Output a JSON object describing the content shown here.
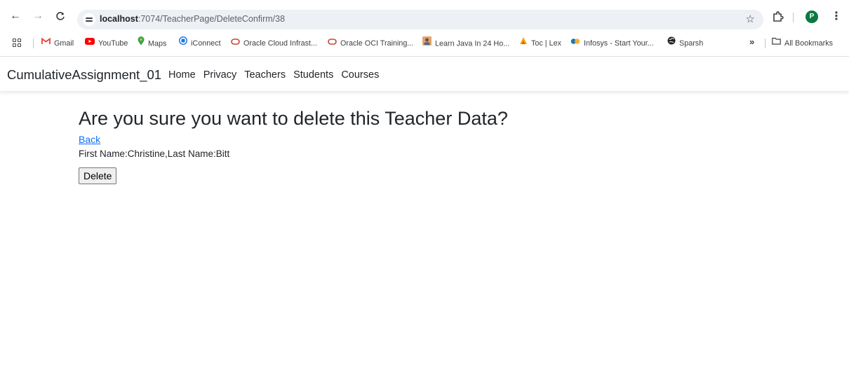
{
  "browser": {
    "url_host": "localhost",
    "url_path": ":7074/TeacherPage/DeleteConfirm/38",
    "profile_initial": "P",
    "bookmarks": [
      {
        "label": "Gmail",
        "icon": "gmail-icon",
        "color": "#ea4335"
      },
      {
        "label": "YouTube",
        "icon": "youtube-icon",
        "color": "#ff0000"
      },
      {
        "label": "Maps",
        "icon": "maps-pin-icon",
        "color": "#34a853"
      },
      {
        "label": "iConnect",
        "icon": "iconnect-icon",
        "color": "#1a73e8"
      },
      {
        "label": "Oracle Cloud Infrast...",
        "icon": "oracle-icon",
        "color": "#c74634"
      },
      {
        "label": "Oracle OCI Training...",
        "icon": "oracle-icon",
        "color": "#c74634"
      },
      {
        "label": "Learn Java In 24 Ho...",
        "icon": "java-book-icon",
        "color": "#8a4b2a"
      },
      {
        "label": "Toc | Lex",
        "icon": "lex-icon",
        "color": "#f2a900"
      },
      {
        "label": "Infosys - Start Your...",
        "icon": "infosys-icon",
        "color": "#007cc3"
      },
      {
        "label": "Sparsh",
        "icon": "sparsh-globe-icon",
        "color": "#202124"
      }
    ],
    "more_label": "»",
    "all_bookmarks_label": "All Bookmarks"
  },
  "navbar": {
    "brand": "CumulativeAssignment_01",
    "links": [
      "Home",
      "Privacy",
      "Teachers",
      "Students",
      "Courses"
    ]
  },
  "main": {
    "heading": "Are you sure you want to delete this Teacher Data?",
    "back_link": "Back",
    "teacher_info": "First Name:Christine,Last Name:Bitt",
    "delete_button": "Delete"
  },
  "colors": {
    "link": "#0d6efd",
    "profile_badge": "#0a7a42"
  }
}
